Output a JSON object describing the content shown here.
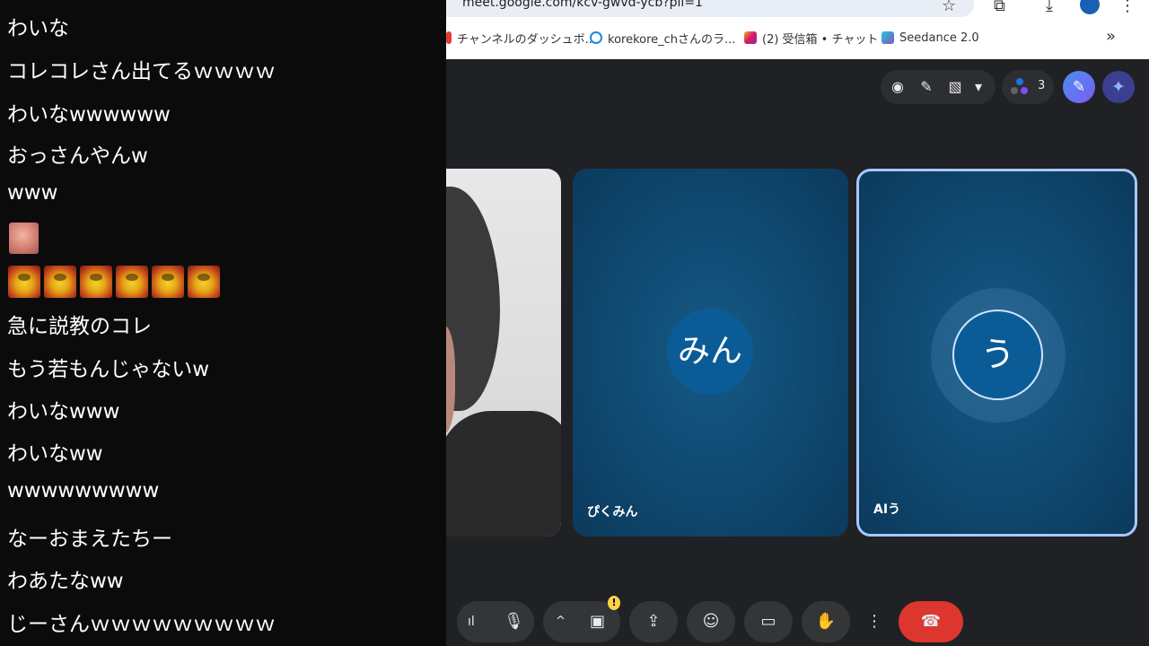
{
  "chat": {
    "lines": [
      "わいな",
      "コレコレさん出てるｗｗｗｗ",
      "わいなwwwwww",
      "おっさんやんw",
      "www",
      "急に説教のコレ",
      "もう若もんじゃないw",
      "わいなwww",
      "わいなww",
      "wwwwwwwww",
      "なーおまえたちー",
      "わあたなww",
      "じーさんｗｗｗｗｗｗｗｗｗ"
    ]
  },
  "browser": {
    "url": "meet.google.com/kcv-gwvd-ycb?pli=1",
    "bookmarks": [
      "チャンネルのダッシュボ...",
      "korekore_chさんのラ...",
      "(2) 受信箱 • チャット",
      "Seedance 2.0"
    ],
    "more_icon": "chevron-double-right"
  },
  "meet": {
    "people_count": "3",
    "tiles": [
      {
        "name": "ぴくみん",
        "avatar": "みん"
      },
      {
        "name": "AIう",
        "avatar": "う"
      }
    ],
    "colors": {
      "tile_bg": "#0f4870",
      "end_call": "#dc362e",
      "active_border": "#a8c7fa"
    }
  }
}
